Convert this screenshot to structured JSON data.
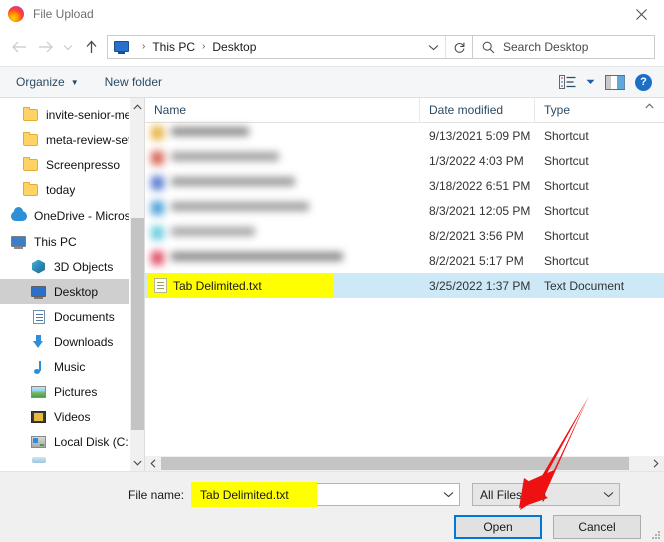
{
  "window": {
    "title": "File Upload",
    "app_icon": "firefox-logo-icon",
    "close_label": "✕"
  },
  "navbar": {
    "back_icon": "back-arrow-icon",
    "forward_icon": "forward-arrow-icon",
    "recent_icon": "recent-locations-chevron-icon",
    "up_icon": "up-arrow-icon",
    "breadcrumb_icon": "this-pc-monitor-icon",
    "breadcrumb": [
      "This PC",
      "Desktop"
    ],
    "separator": "›",
    "dropdown_icon": "chevron-down-icon",
    "refresh_icon": "↻",
    "search": {
      "icon": "search-magnifier-icon",
      "placeholder": "Search Desktop",
      "value": ""
    }
  },
  "commandbar": {
    "organize_label": "Organize",
    "organize_caret": "▼",
    "new_folder_label": "New folder",
    "view_icon": "list-view-icon",
    "view_caret": "▼",
    "preview_pane_icon": "preview-pane-icon",
    "help_label": "?"
  },
  "sidebar": {
    "items": [
      {
        "label": "invite-senior-me",
        "icon": "folder-icon",
        "indent": 1,
        "selected": false
      },
      {
        "label": "meta-review-set",
        "icon": "folder-icon",
        "indent": 1,
        "selected": false
      },
      {
        "label": "Screenpresso",
        "icon": "folder-icon",
        "indent": 1,
        "selected": false
      },
      {
        "label": "today",
        "icon": "folder-icon",
        "indent": 1,
        "selected": false
      },
      {
        "label": "OneDrive - Micros",
        "icon": "onedrive-cloud-icon",
        "indent": 0,
        "selected": false
      },
      {
        "label": "This PC",
        "icon": "this-pc-icon",
        "indent": 0,
        "selected": false
      },
      {
        "label": "3D Objects",
        "icon": "3d-objects-icon",
        "indent": 1,
        "selected": false
      },
      {
        "label": "Desktop",
        "icon": "desktop-icon",
        "indent": 1,
        "selected": true
      },
      {
        "label": "Documents",
        "icon": "documents-icon",
        "indent": 1,
        "selected": false
      },
      {
        "label": "Downloads",
        "icon": "downloads-icon",
        "indent": 1,
        "selected": false
      },
      {
        "label": "Music",
        "icon": "music-icon",
        "indent": 1,
        "selected": false
      },
      {
        "label": "Pictures",
        "icon": "pictures-icon",
        "indent": 1,
        "selected": false
      },
      {
        "label": "Videos",
        "icon": "videos-icon",
        "indent": 1,
        "selected": false
      },
      {
        "label": "Local Disk (C:)",
        "icon": "local-disk-icon",
        "indent": 1,
        "selected": false
      }
    ],
    "scrollbar": {
      "up_arrow": "⌃",
      "down_arrow": "⌄"
    }
  },
  "filelist": {
    "columns": {
      "name": "Name",
      "date_modified": "Date modified",
      "type": "Type"
    },
    "sort_indicator": "⌃",
    "rows": [
      {
        "name": "",
        "redacted": true,
        "date": "9/13/2021 5:09 PM",
        "type": "Shortcut",
        "selected": false
      },
      {
        "name": "",
        "redacted": true,
        "date": "1/3/2022 4:03 PM",
        "type": "Shortcut",
        "selected": false
      },
      {
        "name": "",
        "redacted": true,
        "date": "3/18/2022 6:51 PM",
        "type": "Shortcut",
        "selected": false
      },
      {
        "name": "",
        "redacted": true,
        "date": "8/3/2021 12:05 PM",
        "type": "Shortcut",
        "selected": false
      },
      {
        "name": "",
        "redacted": true,
        "date": "8/2/2021 3:56 PM",
        "type": "Shortcut",
        "selected": false
      },
      {
        "name": "",
        "redacted": true,
        "date": "8/2/2021 5:17 PM",
        "type": "Shortcut",
        "selected": false
      },
      {
        "name": "Tab Delimited.txt",
        "redacted": false,
        "date": "3/25/2022 1:37 PM",
        "type": "Text Document",
        "selected": true
      }
    ],
    "hscroll": {
      "left_arrow": "‹",
      "right_arrow": "›"
    }
  },
  "footer": {
    "file_name_label": "File name:",
    "file_name_value": "Tab Delimited.txt",
    "file_name_caret": "⌄",
    "filter_value": "All Files (*.*)",
    "filter_caret": "⌄",
    "open_label": "Open",
    "cancel_label": "Cancel"
  },
  "annotations": {
    "highlight_color": "#ffff00",
    "arrow_color": "#ee1111",
    "arrow_target": "open-button",
    "selection_color": "#cde8f7",
    "focus_color": "#0078d7"
  }
}
